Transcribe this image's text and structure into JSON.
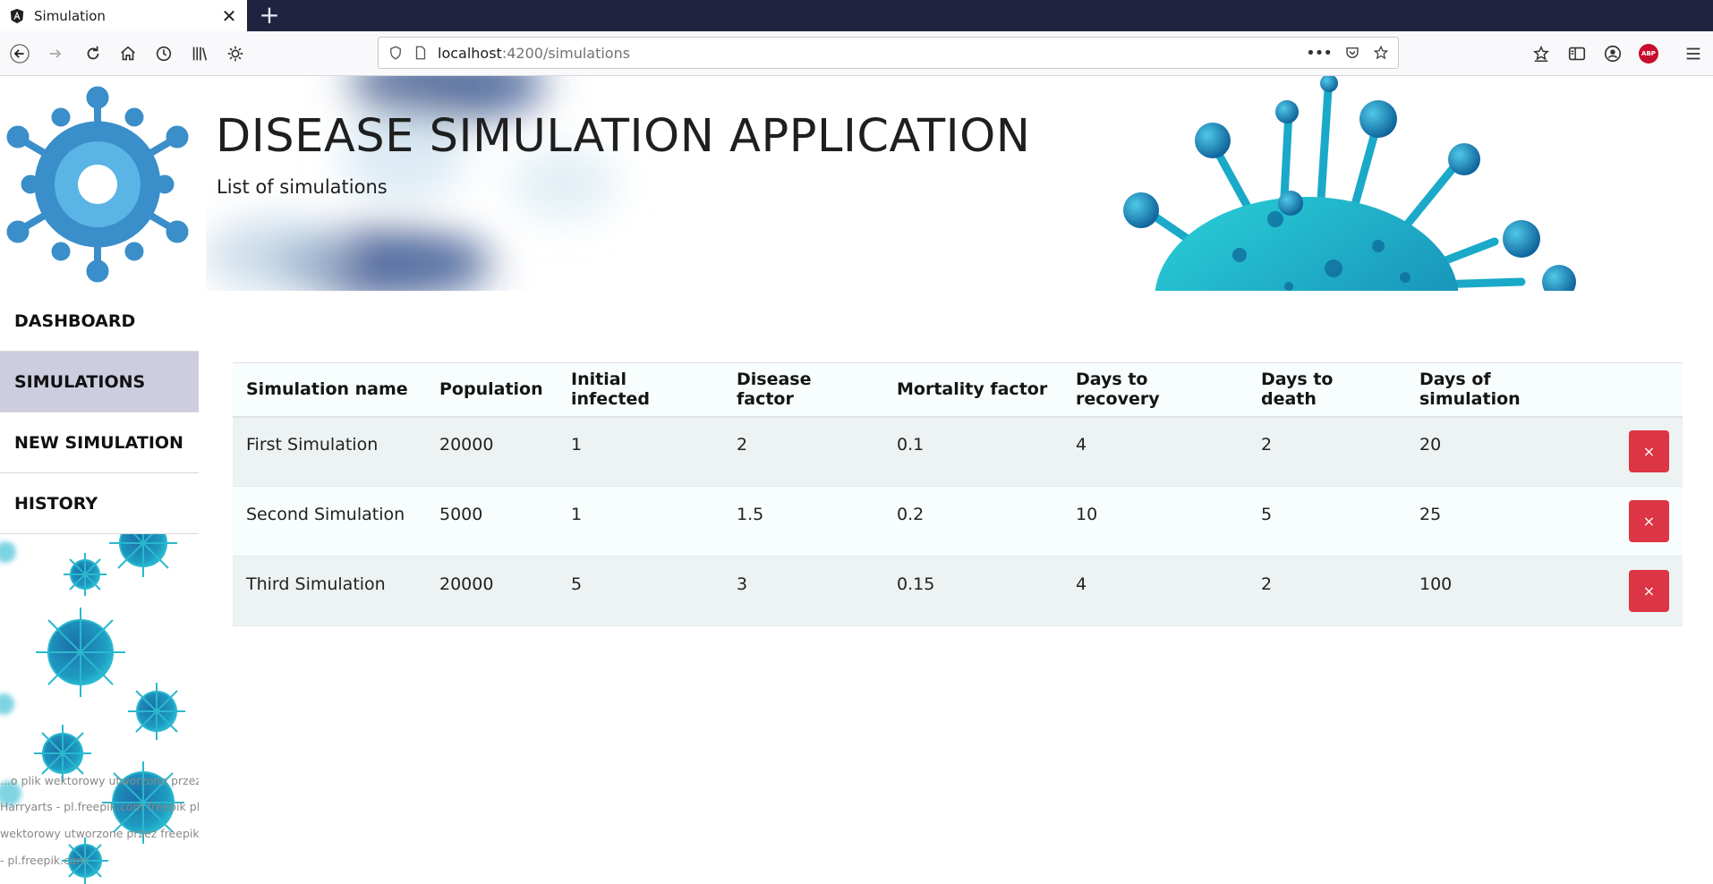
{
  "browser": {
    "tab_title": "Simulation",
    "tab_close": "✕",
    "new_tab": "+",
    "url_host": "localhost",
    "url_rest": ":4200/simulations",
    "page_actions": "•••",
    "abp_label": "ABP"
  },
  "header": {
    "title": "DISEASE SIMULATION APPLICATION",
    "subtitle": "List of simulations"
  },
  "sidebar": {
    "items": [
      {
        "label": "DASHBOARD",
        "active": false
      },
      {
        "label": "SIMULATIONS",
        "active": true
      },
      {
        "label": "NEW SIMULATION",
        "active": false
      },
      {
        "label": "HISTORY",
        "active": false
      }
    ],
    "credits": [
      "...o plik wektorowy utworzone przez",
      "Harryarts - pl.freepik.com freepik plik",
      "wektorowy utworzone przez freepik",
      "- pl.freepik.com"
    ]
  },
  "table": {
    "headers": [
      "Simulation name",
      "Population",
      "Initial infected",
      "Disease factor",
      "Mortality factor",
      "Days to recovery",
      "Days to death",
      "Days of simulation",
      ""
    ],
    "rows": [
      [
        "First Simulation",
        "20000",
        "1",
        "2",
        "0.1",
        "4",
        "2",
        "20"
      ],
      [
        "Second Simulation",
        "5000",
        "1",
        "1.5",
        "0.2",
        "10",
        "5",
        "25"
      ],
      [
        "Third Simulation",
        "20000",
        "5",
        "3",
        "0.15",
        "4",
        "2",
        "100"
      ]
    ],
    "delete_label": "×"
  },
  "colors": {
    "tabstrip": "#1f2340",
    "active_nav": "#cccde0",
    "delete_button": "#dc3545",
    "virus_teal": "#21b8c8",
    "virus_blue": "#3a8ec9"
  }
}
